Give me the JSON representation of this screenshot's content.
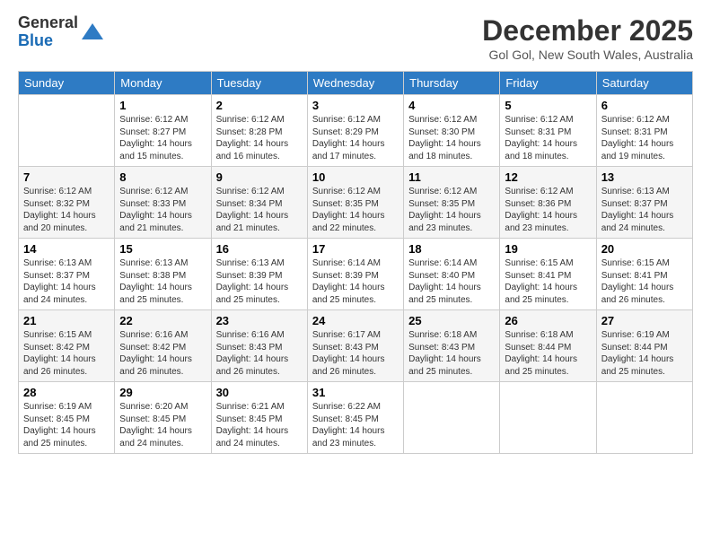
{
  "logo": {
    "general": "General",
    "blue": "Blue"
  },
  "title": "December 2025",
  "location": "Gol Gol, New South Wales, Australia",
  "days_of_week": [
    "Sunday",
    "Monday",
    "Tuesday",
    "Wednesday",
    "Thursday",
    "Friday",
    "Saturday"
  ],
  "weeks": [
    [
      {
        "day": "",
        "info": ""
      },
      {
        "day": "1",
        "info": "Sunrise: 6:12 AM\nSunset: 8:27 PM\nDaylight: 14 hours\nand 15 minutes."
      },
      {
        "day": "2",
        "info": "Sunrise: 6:12 AM\nSunset: 8:28 PM\nDaylight: 14 hours\nand 16 minutes."
      },
      {
        "day": "3",
        "info": "Sunrise: 6:12 AM\nSunset: 8:29 PM\nDaylight: 14 hours\nand 17 minutes."
      },
      {
        "day": "4",
        "info": "Sunrise: 6:12 AM\nSunset: 8:30 PM\nDaylight: 14 hours\nand 18 minutes."
      },
      {
        "day": "5",
        "info": "Sunrise: 6:12 AM\nSunset: 8:31 PM\nDaylight: 14 hours\nand 18 minutes."
      },
      {
        "day": "6",
        "info": "Sunrise: 6:12 AM\nSunset: 8:31 PM\nDaylight: 14 hours\nand 19 minutes."
      }
    ],
    [
      {
        "day": "7",
        "info": "Sunrise: 6:12 AM\nSunset: 8:32 PM\nDaylight: 14 hours\nand 20 minutes."
      },
      {
        "day": "8",
        "info": "Sunrise: 6:12 AM\nSunset: 8:33 PM\nDaylight: 14 hours\nand 21 minutes."
      },
      {
        "day": "9",
        "info": "Sunrise: 6:12 AM\nSunset: 8:34 PM\nDaylight: 14 hours\nand 21 minutes."
      },
      {
        "day": "10",
        "info": "Sunrise: 6:12 AM\nSunset: 8:35 PM\nDaylight: 14 hours\nand 22 minutes."
      },
      {
        "day": "11",
        "info": "Sunrise: 6:12 AM\nSunset: 8:35 PM\nDaylight: 14 hours\nand 23 minutes."
      },
      {
        "day": "12",
        "info": "Sunrise: 6:12 AM\nSunset: 8:36 PM\nDaylight: 14 hours\nand 23 minutes."
      },
      {
        "day": "13",
        "info": "Sunrise: 6:13 AM\nSunset: 8:37 PM\nDaylight: 14 hours\nand 24 minutes."
      }
    ],
    [
      {
        "day": "14",
        "info": "Sunrise: 6:13 AM\nSunset: 8:37 PM\nDaylight: 14 hours\nand 24 minutes."
      },
      {
        "day": "15",
        "info": "Sunrise: 6:13 AM\nSunset: 8:38 PM\nDaylight: 14 hours\nand 25 minutes."
      },
      {
        "day": "16",
        "info": "Sunrise: 6:13 AM\nSunset: 8:39 PM\nDaylight: 14 hours\nand 25 minutes."
      },
      {
        "day": "17",
        "info": "Sunrise: 6:14 AM\nSunset: 8:39 PM\nDaylight: 14 hours\nand 25 minutes."
      },
      {
        "day": "18",
        "info": "Sunrise: 6:14 AM\nSunset: 8:40 PM\nDaylight: 14 hours\nand 25 minutes."
      },
      {
        "day": "19",
        "info": "Sunrise: 6:15 AM\nSunset: 8:41 PM\nDaylight: 14 hours\nand 25 minutes."
      },
      {
        "day": "20",
        "info": "Sunrise: 6:15 AM\nSunset: 8:41 PM\nDaylight: 14 hours\nand 26 minutes."
      }
    ],
    [
      {
        "day": "21",
        "info": "Sunrise: 6:15 AM\nSunset: 8:42 PM\nDaylight: 14 hours\nand 26 minutes."
      },
      {
        "day": "22",
        "info": "Sunrise: 6:16 AM\nSunset: 8:42 PM\nDaylight: 14 hours\nand 26 minutes."
      },
      {
        "day": "23",
        "info": "Sunrise: 6:16 AM\nSunset: 8:43 PM\nDaylight: 14 hours\nand 26 minutes."
      },
      {
        "day": "24",
        "info": "Sunrise: 6:17 AM\nSunset: 8:43 PM\nDaylight: 14 hours\nand 26 minutes."
      },
      {
        "day": "25",
        "info": "Sunrise: 6:18 AM\nSunset: 8:43 PM\nDaylight: 14 hours\nand 25 minutes."
      },
      {
        "day": "26",
        "info": "Sunrise: 6:18 AM\nSunset: 8:44 PM\nDaylight: 14 hours\nand 25 minutes."
      },
      {
        "day": "27",
        "info": "Sunrise: 6:19 AM\nSunset: 8:44 PM\nDaylight: 14 hours\nand 25 minutes."
      }
    ],
    [
      {
        "day": "28",
        "info": "Sunrise: 6:19 AM\nSunset: 8:45 PM\nDaylight: 14 hours\nand 25 minutes."
      },
      {
        "day": "29",
        "info": "Sunrise: 6:20 AM\nSunset: 8:45 PM\nDaylight: 14 hours\nand 24 minutes."
      },
      {
        "day": "30",
        "info": "Sunrise: 6:21 AM\nSunset: 8:45 PM\nDaylight: 14 hours\nand 24 minutes."
      },
      {
        "day": "31",
        "info": "Sunrise: 6:22 AM\nSunset: 8:45 PM\nDaylight: 14 hours\nand 23 minutes."
      },
      {
        "day": "",
        "info": ""
      },
      {
        "day": "",
        "info": ""
      },
      {
        "day": "",
        "info": ""
      }
    ]
  ]
}
